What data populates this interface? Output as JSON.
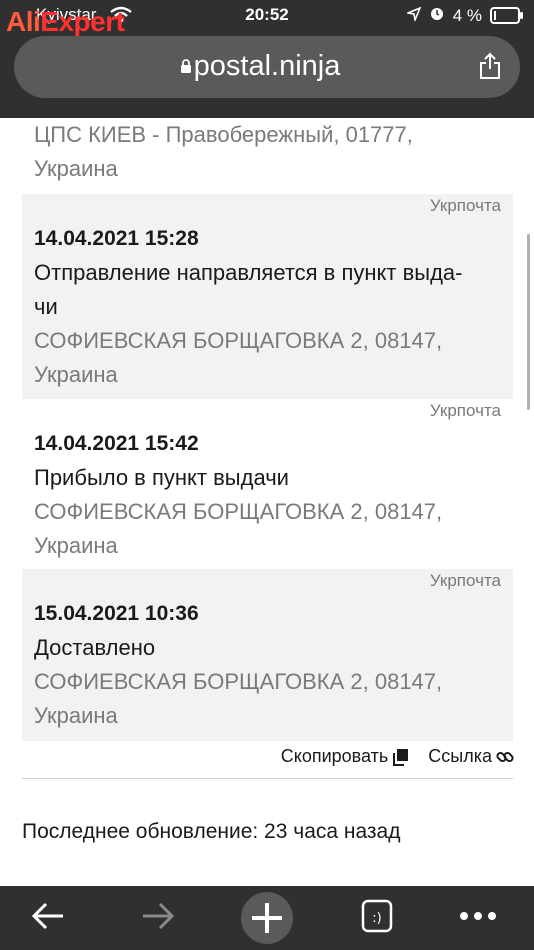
{
  "watermark": {
    "part1": "Ali",
    "part2": "Expert"
  },
  "status_bar": {
    "carrier": "Kyivstar",
    "time": "20:52",
    "battery": "4 %",
    "battery_level": 0.04
  },
  "browser": {
    "url": "postal.ninja"
  },
  "first_location": {
    "line1": "ЦПС КИЕВ - Правобережный, 01777,",
    "line2": "Украина"
  },
  "events": [
    {
      "source": "Укрпочта",
      "date": "14.04.2021 15:28",
      "status_line1": "Отправление направляется в пункт выда-",
      "status_line2": "чи",
      "loc_line1": "СОФИЕВСКАЯ БОРЩАГОВКА 2, 08147,",
      "loc_line2": "Украина",
      "shaded": true
    },
    {
      "source": "Укрпочта",
      "date": "14.04.2021 15:42",
      "status_line1": "Прибыло в пункт выдачи",
      "loc_line1": "СОФИЕВСКАЯ БОРЩАГОВКА 2, 08147,",
      "loc_line2": "Украина",
      "shaded": false
    },
    {
      "source": "Укрпочта",
      "date": "15.04.2021 10:36",
      "status_line1": "Доставлено",
      "loc_line1": "СОФИЕВСКАЯ БОРЩАГОВКА 2, 08147,",
      "loc_line2": "Украина",
      "shaded": true
    }
  ],
  "actions": {
    "copy": "Скопировать",
    "link": "Ссылка"
  },
  "last_update": "Последнее обновление: 23 часа назад",
  "icons": [
    "wifi-icon",
    "location-arrow-icon",
    "alarm-icon",
    "battery-icon",
    "lock-icon",
    "share-icon",
    "copy-icon",
    "link-icon",
    "back-icon",
    "forward-icon",
    "new-tab-icon",
    "tabs-icon",
    "more-icon"
  ],
  "colors": {
    "chrome": "#303030",
    "urlbar": "#5a5a5a",
    "card": "#f2f2f2",
    "muted": "#7a7a7a"
  }
}
